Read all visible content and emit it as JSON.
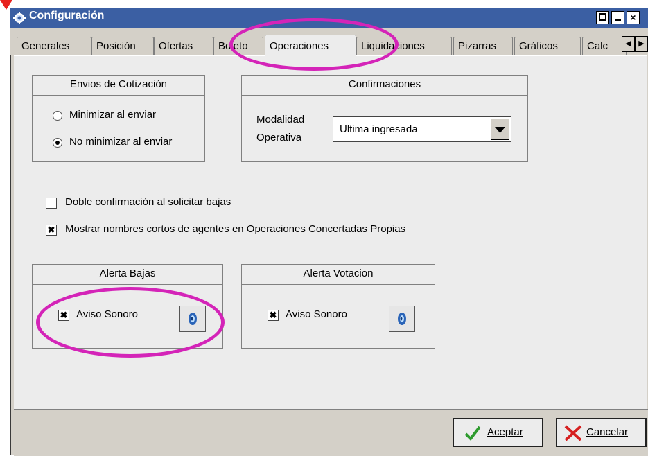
{
  "window": {
    "title": "Configuración",
    "controls": {
      "minimize": "▔",
      "restore": "_",
      "close": "×"
    },
    "accent": "#3b5fa3"
  },
  "tabs": [
    {
      "label": "Generales"
    },
    {
      "label": "Posición"
    },
    {
      "label": "Ofertas"
    },
    {
      "label": "Boleto"
    },
    {
      "label": "Operaciones",
      "active": true
    },
    {
      "label": "Liquidaciones"
    },
    {
      "label": "Pizarras"
    },
    {
      "label": "Gráficos"
    },
    {
      "label": "Calc"
    }
  ],
  "tab_scroll": {
    "left": "◀",
    "right": "▶"
  },
  "envios": {
    "title": "Envios de Cotización",
    "options": [
      {
        "label": "Minimizar al enviar",
        "selected": false
      },
      {
        "label": "No minimizar al enviar",
        "selected": true
      }
    ]
  },
  "confirmaciones": {
    "title": "Confirmaciones",
    "label_line1": "Modalidad",
    "label_line2": "Operativa",
    "select_value": "Ultima ingresada"
  },
  "checks": {
    "doble": {
      "label": "Doble confirmación al solicitar bajas",
      "checked": false
    },
    "nombres": {
      "label": "Mostrar nombres cortos de agentes en Operaciones Concertadas Propias",
      "checked": true
    },
    "mark": "✖"
  },
  "alerta_bajas": {
    "title": "Alerta Bajas",
    "aviso_label": "Aviso Sonoro",
    "checked": true
  },
  "alerta_votacion": {
    "title": "Alerta Votacion",
    "aviso_label": "Aviso Sonoro",
    "checked": true
  },
  "buttons": {
    "accept": "Aceptar",
    "cancel": "Cancelar"
  },
  "highlight_color": "#d424b8"
}
